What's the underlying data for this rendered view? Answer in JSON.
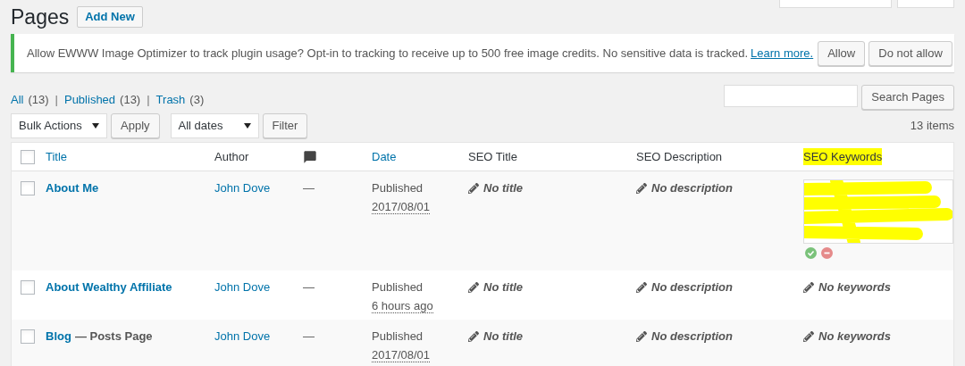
{
  "page_title": "Pages",
  "add_new": "Add New",
  "notice": {
    "text": "Allow EWWW Image Optimizer to track plugin usage? Opt-in to tracking to receive up to 500 free image credits. No sensitive data is tracked.",
    "link": "Learn more.",
    "buttons": [
      "Allow",
      "Do not allow"
    ]
  },
  "views": [
    {
      "label": "All",
      "count": "(13)"
    },
    {
      "separator": "|",
      "label": "Published",
      "count": "(13)"
    },
    {
      "separator": "|",
      "label": "Trash",
      "count": "(3)"
    }
  ],
  "select_all_checked": false,
  "search": {
    "button": "Search Pages"
  },
  "bulk_actions": {
    "value": "Bulk Actions",
    "button": "Apply"
  },
  "dates": {
    "value": "All dates",
    "button": "Filter"
  },
  "item_count": "13 items",
  "columns": [
    {
      "label": "Title",
      "sortable": true
    },
    {
      "label": "Author",
      "sortable": false
    },
    {
      "label": "Date",
      "sortable": true
    },
    {
      "label": "SEO Title",
      "sortable": false
    },
    {
      "label": "SEO Description",
      "sortable": false
    },
    {
      "label": "SEO Keywords",
      "sortable": false,
      "highlighted": true
    }
  ],
  "rows": [
    {
      "checked": false,
      "title": "About Me",
      "author": "John Dove",
      "comments": "—",
      "status": "Published",
      "date": "2017/08/01",
      "seo_title": "No title",
      "seo_description": "No description",
      "seo_keywords": {
        "kind": "editor"
      }
    },
    {
      "checked": false,
      "title": "About Wealthy Affiliate",
      "author": "John Dove",
      "comments": "—",
      "status": "Published",
      "date": "6 hours ago",
      "seo_title": "No title",
      "seo_description": "No description",
      "seo_keywords": {
        "kind": "text",
        "text": "No keywords"
      }
    },
    {
      "checked": false,
      "title": "Blog",
      "post_state": "— Posts Page",
      "author": "John Dove",
      "comments": "—",
      "status": "Published",
      "date": "2017/08/01",
      "seo_title": "No title",
      "seo_description": "No description",
      "seo_keywords": {
        "kind": "text",
        "text": "No keywords"
      }
    }
  ]
}
